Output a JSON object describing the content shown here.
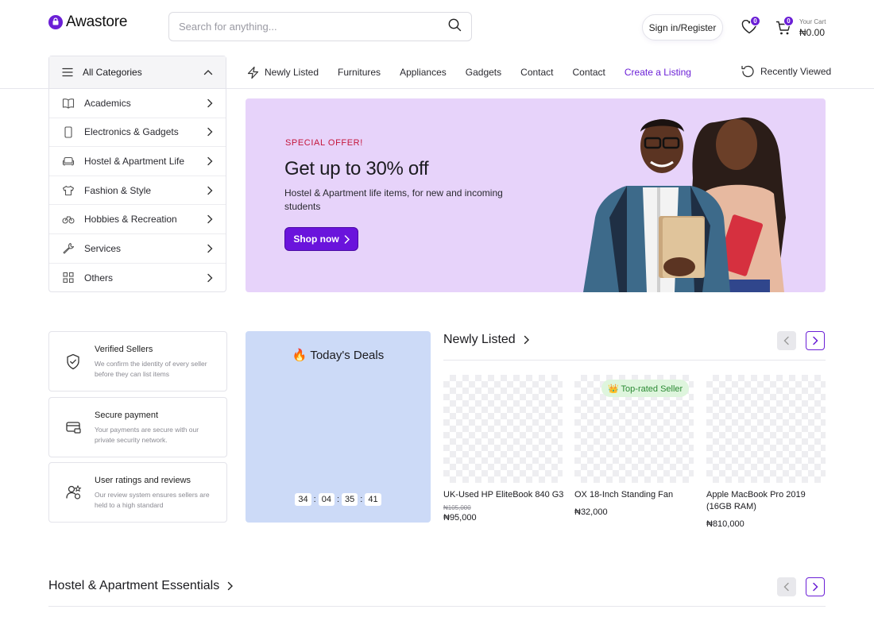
{
  "brand": {
    "name": "Awastore"
  },
  "header": {
    "search_placeholder": "Search for anything...",
    "signin_label": "Sign in/Register",
    "wishlist_count": "0",
    "cart_count": "0",
    "cart_label": "Your Cart",
    "cart_total": "₦0.00"
  },
  "categories": {
    "title": "All Categories",
    "items": [
      {
        "label": "Academics",
        "icon": "book-icon"
      },
      {
        "label": "Electronics & Gadgets",
        "icon": "phone-icon"
      },
      {
        "label": "Hostel & Apartment Life",
        "icon": "sofa-icon"
      },
      {
        "label": "Fashion & Style",
        "icon": "shirt-icon"
      },
      {
        "label": "Hobbies & Recreation",
        "icon": "gamepad-icon"
      },
      {
        "label": "Services",
        "icon": "wrench-icon"
      },
      {
        "label": "Others",
        "icon": "grid-icon"
      }
    ]
  },
  "nav": {
    "links": [
      "Newly Listed",
      "Furnitures",
      "Appliances",
      "Gadgets",
      "Contact",
      "Contact",
      "Create a Listing"
    ],
    "recently_viewed": "Recently Viewed",
    "accent_color": "#6b1fd6"
  },
  "hero": {
    "eyebrow": "SPECIAL OFFER!",
    "title": "Get up to 30% off",
    "subtitle": "Hostel & Apartment life items, for new and incoming students",
    "cta": "Shop now",
    "background": "#e7d3fa"
  },
  "features": [
    {
      "title": "Verified Sellers",
      "desc": "We confirm the identity of every seller before they can list items",
      "icon": "shield-check-icon"
    },
    {
      "title": "Secure payment",
      "desc": "Your payments are secure with our private security network.",
      "icon": "card-lock-icon"
    },
    {
      "title": "User ratings and reviews",
      "desc": "Our review system ensures sellers are held to a high standard",
      "icon": "user-star-icon"
    }
  ],
  "deals": {
    "title": "🔥 Today's Deals",
    "timer": [
      "34",
      "04",
      "35",
      "41"
    ],
    "separator": ":"
  },
  "newly_listed": {
    "title": "Newly Listed",
    "badge": "👑 Top-rated Seller",
    "products": [
      {
        "name": "UK-Used HP EliteBook 840 G3",
        "old_price": "₦105,000",
        "price": "₦95,000"
      },
      {
        "name": "OX 18-Inch Standing Fan",
        "price": "₦32,000"
      },
      {
        "name": "Apple MacBook Pro 2019 (16GB RAM)",
        "price": "₦810,000"
      }
    ]
  },
  "hostel_section": {
    "title": "Hostel & Apartment Essentials"
  }
}
